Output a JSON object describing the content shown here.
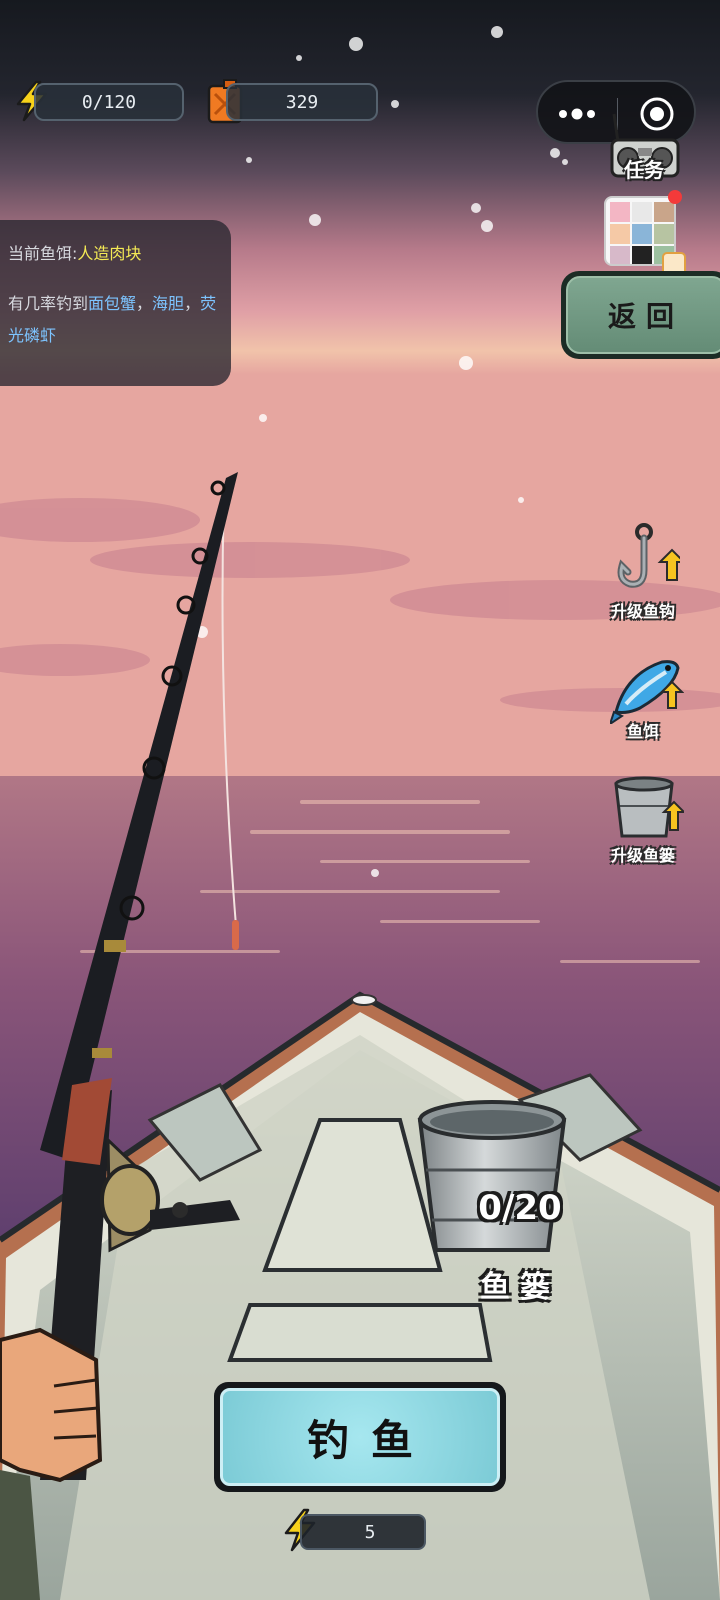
{
  "hud": {
    "energy": "0/120",
    "fuel": "329"
  },
  "capsule": {
    "more_icon": "more-dots-icon",
    "close_icon": "target-circle-icon"
  },
  "task": {
    "label": "任务"
  },
  "bait_info": {
    "current_prefix": "当前鱼饵:",
    "current_bait": "人造肉块",
    "chance_prefix": "有几率钓到",
    "catch_1": "面包蟹",
    "sep_1": "，",
    "catch_2": "海胆",
    "sep_2": "，",
    "catch_3": "荧光磷虾"
  },
  "back_button": {
    "label": "返回"
  },
  "side_menu": {
    "upgrade_hook": "升级鱼钩",
    "bait": "鱼饵",
    "upgrade_basket": "升级鱼篓"
  },
  "basket": {
    "count": "0/20",
    "label": "鱼篓"
  },
  "fish_button": {
    "label": "钓鱼"
  },
  "cost": {
    "value": "5"
  },
  "colors": {
    "sky_top": "#1b1e25",
    "sky_pink": "#d98d9c",
    "horizon": "#f3c9a4",
    "sea": "#6a3f6a",
    "accent_yellow": "#f4ea55",
    "accent_blue": "#7dc4ff",
    "fish_button": "#9fe0ea",
    "back_button": "#729b84"
  }
}
